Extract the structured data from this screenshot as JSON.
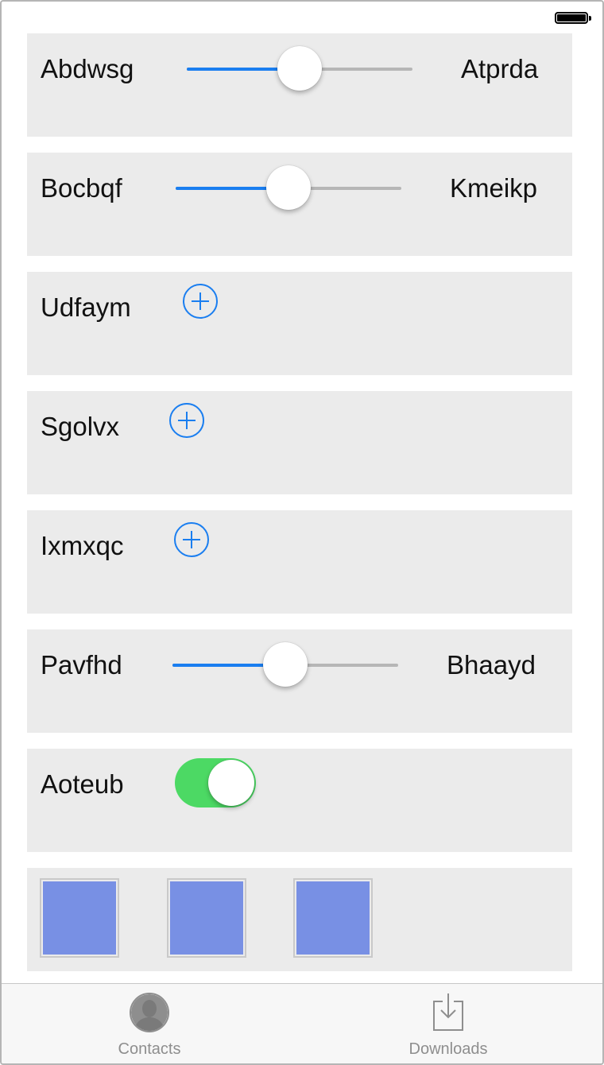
{
  "rows": [
    {
      "type": "slider",
      "label": "Abdwsg",
      "right_label": "Atprda",
      "value": 0.5
    },
    {
      "type": "slider",
      "label": "Bocbqf",
      "right_label": "Kmeikp",
      "value": 0.5
    },
    {
      "type": "add",
      "label": "Udfaym",
      "icon": "plus-circle-icon"
    },
    {
      "type": "add",
      "label": "Sgolvx",
      "icon": "plus-circle-icon"
    },
    {
      "type": "add",
      "label": "Ixmxqc",
      "icon": "plus-circle-icon"
    },
    {
      "type": "slider",
      "label": "Pavfhd",
      "right_label": "Bhaayd",
      "value": 0.5
    },
    {
      "type": "toggle",
      "label": "Aoteub",
      "on": true
    },
    {
      "type": "tiles",
      "count": 3,
      "tile_color": "#7890e4"
    }
  ],
  "tab_bar": {
    "items": [
      {
        "label": "Contacts",
        "icon": "person-icon"
      },
      {
        "label": "Downloads",
        "icon": "download-tray-icon"
      }
    ]
  },
  "status_bar": {
    "battery_icon": "battery-icon",
    "battery_level": 1.0
  },
  "colors": {
    "accent_blue": "#1a7ef0",
    "toggle_green": "#4cd964",
    "row_background": "#ebebeb",
    "tab_inactive": "#8e8e8e"
  }
}
